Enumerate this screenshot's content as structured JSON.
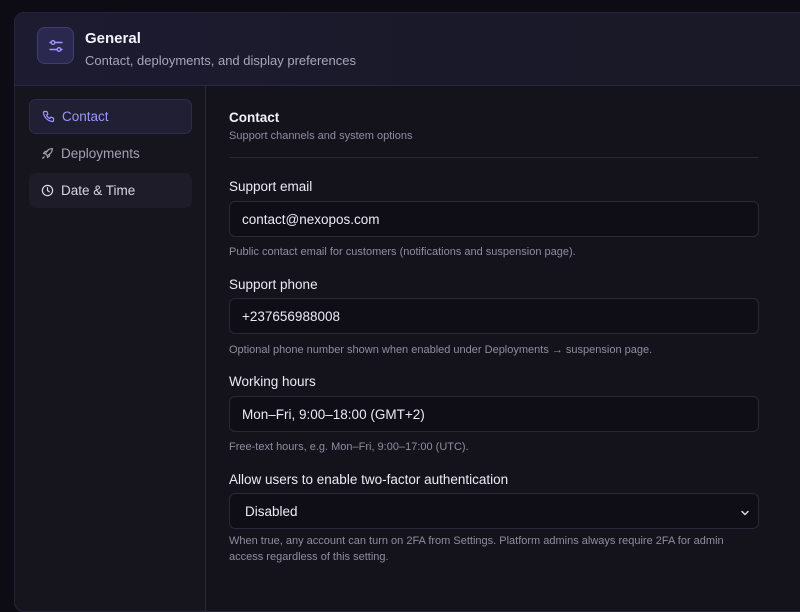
{
  "header": {
    "title": "General",
    "subtitle": "Contact, deployments, and display preferences",
    "icon": "sliders-icon"
  },
  "sidebar": {
    "items": [
      {
        "label": "Contact",
        "icon": "phone-icon",
        "active": true
      },
      {
        "label": "Deployments",
        "icon": "rocket-icon",
        "active": false
      },
      {
        "label": "Date & Time",
        "icon": "clock-icon",
        "active": false
      }
    ]
  },
  "section": {
    "title": "Contact",
    "subtitle": "Support channels and system options"
  },
  "fields": {
    "support_email": {
      "label": "Support email",
      "value": "contact@nexopos.com",
      "help": "Public contact email for customers (notifications and suspension page)."
    },
    "support_phone": {
      "label": "Support phone",
      "value": "+237656988008",
      "help": "Optional phone number shown when enabled under Deployments → suspension page."
    },
    "working_hours": {
      "label": "Working hours",
      "value": "Mon–Fri, 9:00–18:00 (GMT+2)",
      "help": "Free-text hours, e.g. Mon–Fri, 9:00–17:00 (UTC)."
    },
    "two_factor": {
      "label": "Allow users to enable two-factor authentication",
      "value": "Disabled",
      "help": "When true, any account can turn on 2FA from Settings. Platform admins always require 2FA for admin access regardless of this setting."
    }
  },
  "colors": {
    "accent": "#9b97ff",
    "background": "#0d0c14",
    "panel": "#15141d"
  }
}
